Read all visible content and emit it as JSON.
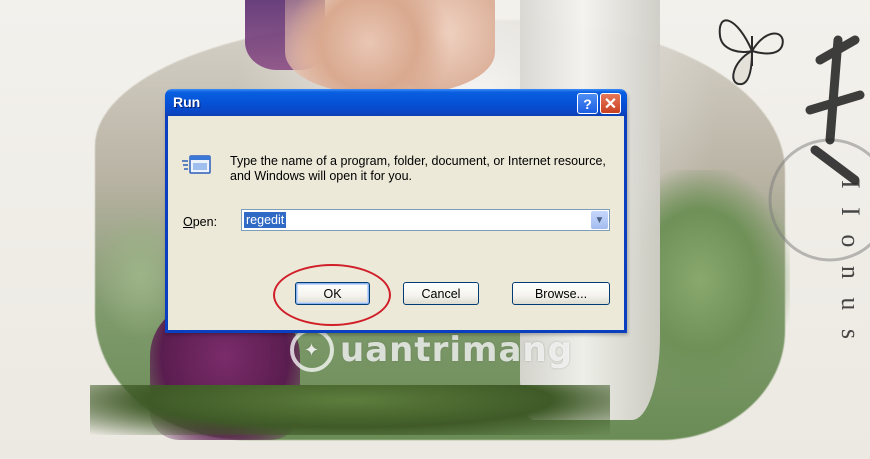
{
  "wallpaper": {
    "watermark_text": "uantrimang",
    "side_text": "I I o n u s"
  },
  "dialog": {
    "title": "Run",
    "help_glyph": "?",
    "close_glyph": "✕",
    "description": "Type the name of a program, folder, document, or Internet resource, and Windows will open it for you.",
    "open_label_prefix": "O",
    "open_label_rest": "pen:",
    "open_value": "regedit",
    "ok_label": "OK",
    "cancel_label": "Cancel",
    "browse_label": "Browse...",
    "icons": {
      "run": "run-program-icon",
      "dropdown": "chevron-down-icon"
    }
  },
  "annotation": {
    "highlight_color": "#d11f2a"
  }
}
